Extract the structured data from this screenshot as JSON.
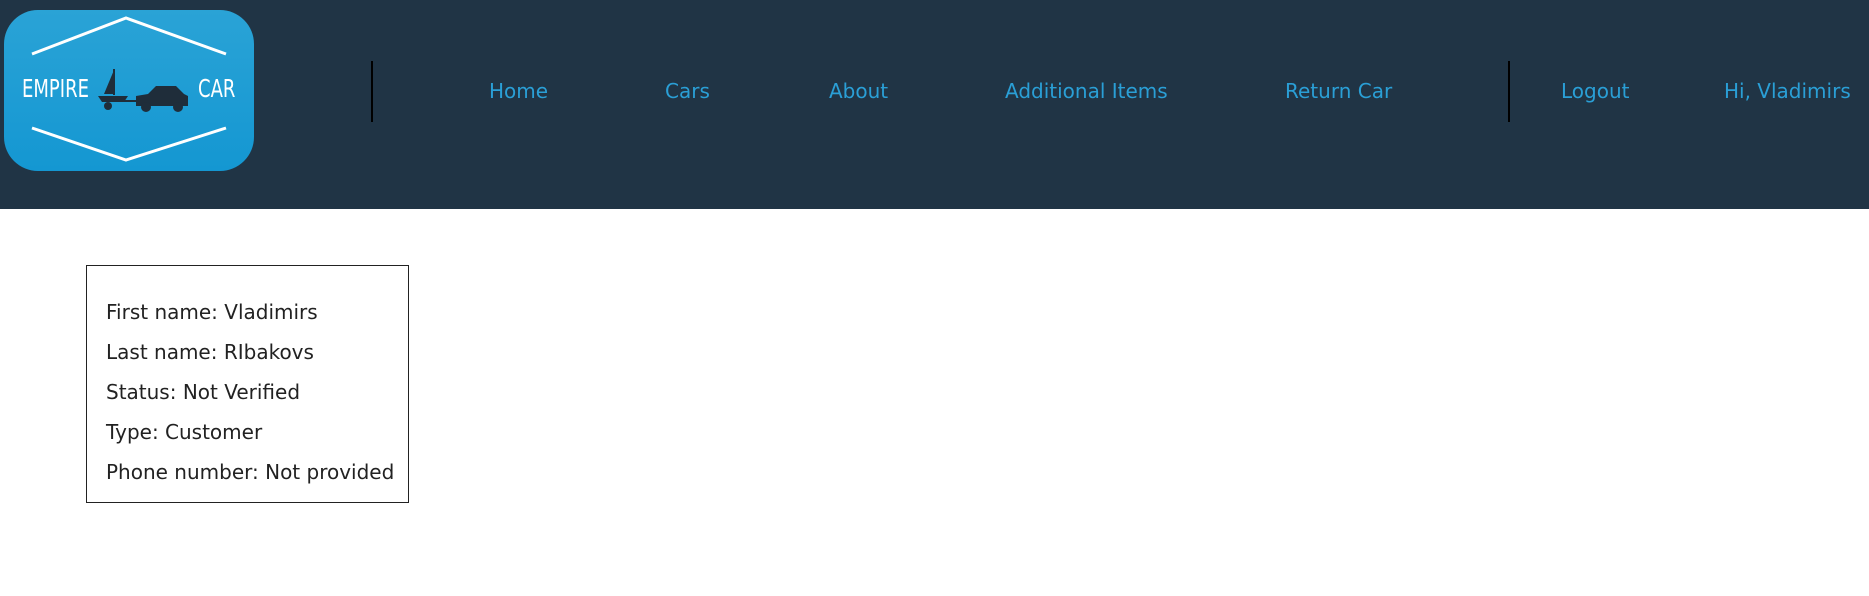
{
  "logo": {
    "left_word": "EMPIRE",
    "right_word": "CAR",
    "icon": "car-towing-boat-icon",
    "background": "#1a9ed6"
  },
  "nav": {
    "home": "Home",
    "cars": "Cars",
    "about": "About",
    "additional_items": "Additional Items",
    "return_car": "Return Car",
    "logout": "Logout",
    "greeting": "Hi, Vladimirs"
  },
  "profile": {
    "first_name": "First name: Vladimirs",
    "last_name": "Last name: RIbakovs",
    "status": "Status: Not Verified",
    "type": "Type: Customer",
    "phone": "Phone number: Not provided"
  },
  "colors": {
    "navbar": "#203445",
    "link": "#2a9fd6",
    "text": "#222222"
  }
}
